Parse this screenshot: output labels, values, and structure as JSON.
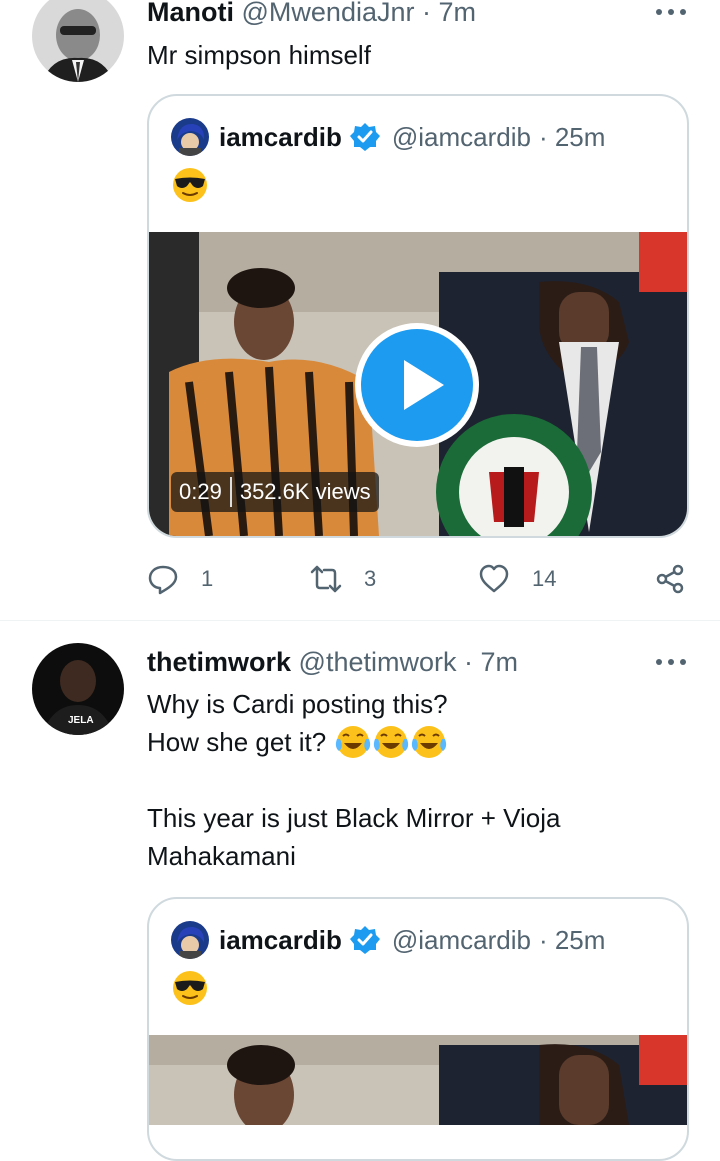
{
  "tweets": [
    {
      "name": "Manoti",
      "handle": "@MwendiaJnr",
      "time": "· 7m",
      "text_lines": [
        "Mr simpson himself"
      ],
      "quote": {
        "name": "iamcardib",
        "handle": "@iamcardib",
        "time": "· 25m",
        "video_duration": "0:29",
        "video_views": "352.6K views"
      },
      "reply_count": "1",
      "retweet_count": "3",
      "like_count": "14"
    },
    {
      "name": "thetimwork",
      "handle": "@thetimwork",
      "time": "· 7m",
      "text_lines": [
        "Why is Cardi posting this?",
        "How she get it?",
        "",
        "This year is just Black Mirror + Vioja",
        "Mahakamani"
      ],
      "quote": {
        "name": "iamcardib",
        "handle": "@iamcardib",
        "time": "· 25m"
      }
    }
  ],
  "colors": {
    "accent": "#1d9bf0",
    "muted": "#536471",
    "border": "#cfd9de"
  },
  "icons": [
    "more-icon",
    "verified-badge-icon",
    "sunglasses-emoji",
    "tears-of-joy-emoji",
    "play-icon",
    "reply-icon",
    "retweet-icon",
    "like-icon",
    "share-icon"
  ]
}
